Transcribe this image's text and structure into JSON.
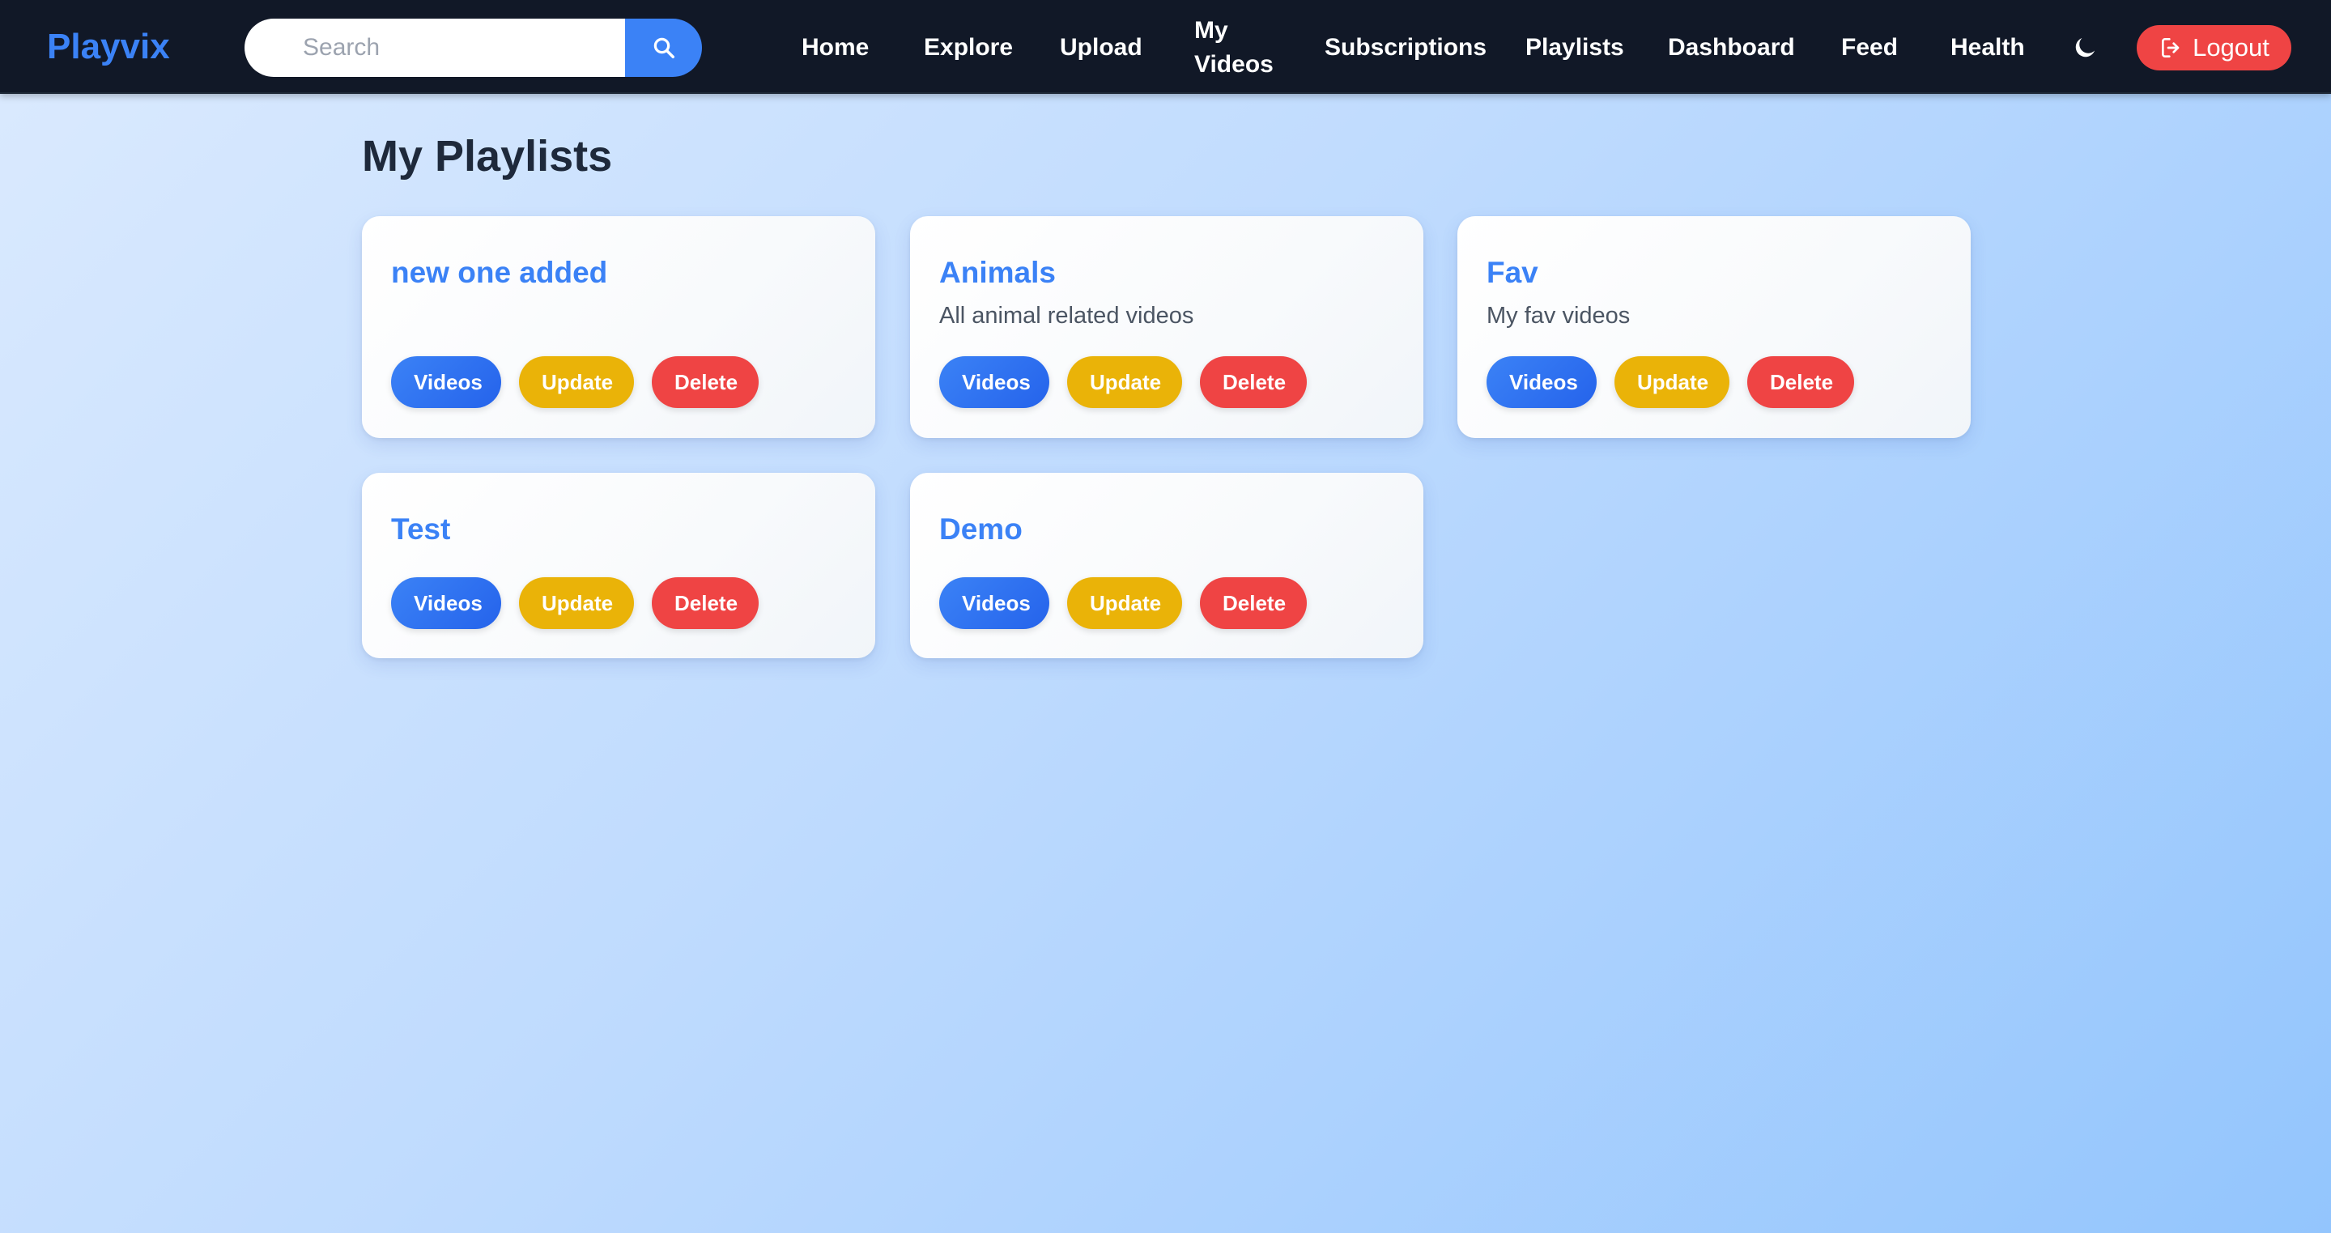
{
  "app": {
    "brand": "Playvix",
    "colors": {
      "navbar": "#111827",
      "accent": "#3b82f6",
      "update": "#eab308",
      "danger": "#ef4444"
    }
  },
  "search": {
    "placeholder": "Search",
    "icon": "search-icon"
  },
  "nav": {
    "items": [
      {
        "label": "Home"
      },
      {
        "label": "Explore"
      },
      {
        "label": "Upload"
      },
      {
        "label": "My Videos"
      },
      {
        "label": "Subscriptions"
      },
      {
        "label": "Playlists"
      },
      {
        "label": "Dashboard"
      },
      {
        "label": "Feed"
      },
      {
        "label": "Health"
      }
    ],
    "theme_icon": "moon-icon",
    "logout_label": "Logout",
    "logout_icon": "logout-icon"
  },
  "main": {
    "title": "My Playlists",
    "playlists": [
      {
        "name": "new one added",
        "description": ""
      },
      {
        "name": "Animals",
        "description": "All animal related videos"
      },
      {
        "name": "Fav",
        "description": "My fav videos"
      },
      {
        "name": "Test",
        "description": ""
      },
      {
        "name": "Demo",
        "description": ""
      }
    ],
    "actions": {
      "videos": "Videos",
      "update": "Update",
      "delete": "Delete"
    }
  }
}
